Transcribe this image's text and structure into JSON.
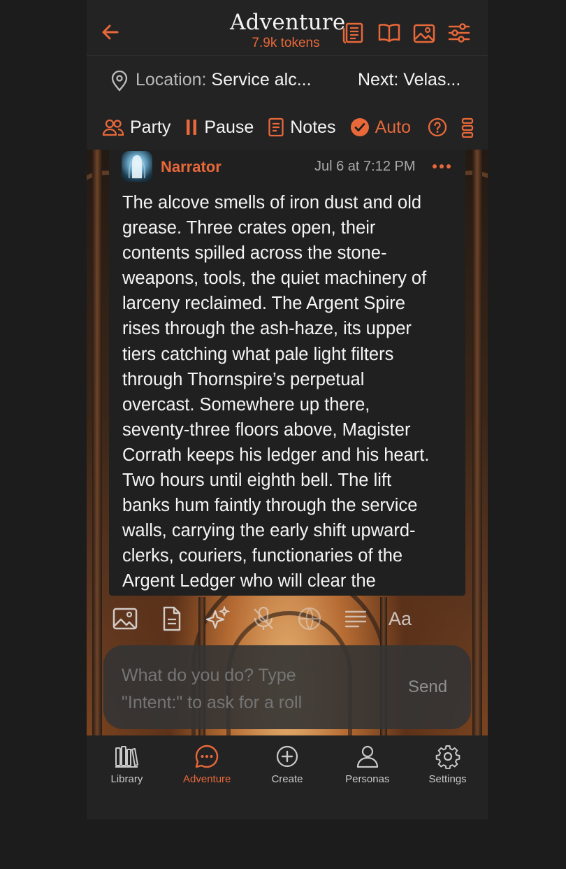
{
  "colors": {
    "accent": "#e8683a",
    "background": "#232323",
    "card": "#202020",
    "text": "#f4f4f4",
    "muted": "#a9a9a9"
  },
  "header": {
    "title": "Adventure",
    "tokens": "7.9k tokens",
    "icons": [
      "back-arrow-icon",
      "newspaper-icon",
      "book-icon",
      "image-icon",
      "sliders-icon"
    ]
  },
  "location": {
    "label": "Location:",
    "value": "Service alc...",
    "next": "Next: Velas..."
  },
  "toolbar": {
    "party": "Party",
    "pause": "Pause",
    "notes": "Notes",
    "auto": "Auto"
  },
  "message": {
    "author": "Narrator",
    "time": "Jul 6 at 7:12 PM",
    "lines": [
      "The alcove smells of iron dust and old",
      "grease. Three crates open, their",
      "contents spilled across the stone-",
      "weapons, tools, the quiet machinery of",
      "larceny reclaimed. The Argent Spire",
      "rises through the ash-haze, its upper",
      "tiers catching what pale light filters",
      "through Thornspire’s perpetual",
      "overcast. Somewhere up there,",
      "seventy-three floors above, Magister",
      "Corrath keeps his ledger and his heart.",
      "Two hours until eighth bell. The lift",
      "banks hum faintly through the service",
      "walls, carrying the early shift upward-",
      "clerks, couriers, functionaries of the",
      "Argent Ledger who will clear the"
    ]
  },
  "composer": {
    "tools_aa": "Aa",
    "placeholder": "What do you do? Type\n\"Intent:\" to ask for a roll",
    "send": "Send"
  },
  "nav": {
    "items": [
      {
        "label": "Library",
        "icon": "library-icon"
      },
      {
        "label": "Adventure",
        "icon": "chat-bubble-icon"
      },
      {
        "label": "Create",
        "icon": "plus-circle-icon"
      },
      {
        "label": "Personas",
        "icon": "person-icon"
      },
      {
        "label": "Settings",
        "icon": "gear-icon"
      }
    ],
    "active": "Adventure"
  }
}
